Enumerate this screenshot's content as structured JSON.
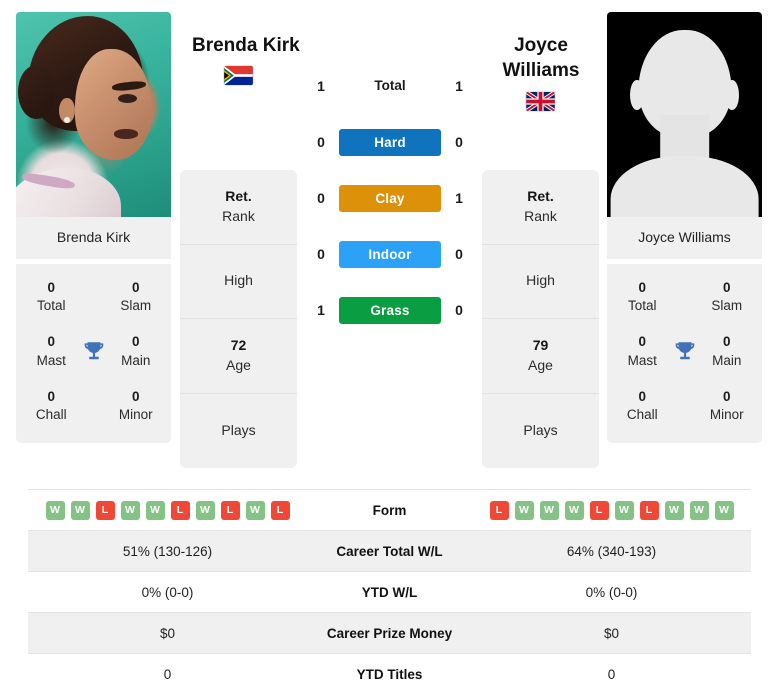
{
  "players": {
    "left": {
      "display_name": "Brenda Kirk",
      "headline": "Brenda Kirk",
      "card_name": "Brenda Kirk",
      "flag": "south-africa-flag",
      "photo": "player-photo",
      "titles": {
        "total": {
          "value": "0",
          "label": "Total"
        },
        "slam": {
          "value": "0",
          "label": "Slam"
        },
        "mast": {
          "value": "0",
          "label": "Mast"
        },
        "main": {
          "value": "0",
          "label": "Main"
        },
        "chall": {
          "value": "0",
          "label": "Chall"
        },
        "minor": {
          "value": "0",
          "label": "Minor"
        }
      },
      "info": {
        "rank_value": "Ret.",
        "rank_label": "Rank",
        "high_value": "",
        "high_label": "High",
        "age_value": "72",
        "age_label": "Age",
        "plays_value": "",
        "plays_label": "Plays"
      },
      "form": [
        "W",
        "W",
        "L",
        "W",
        "W",
        "L",
        "W",
        "L",
        "W",
        "L"
      ],
      "career_total_wl": "51% (130-126)",
      "ytd_wl": "0% (0-0)",
      "career_prize_money": "$0",
      "ytd_titles": "0"
    },
    "right": {
      "display_name": "Joyce Williams",
      "headline_line1": "Joyce",
      "headline_line2": "Williams",
      "card_name": "Joyce Williams",
      "flag": "united-kingdom-flag",
      "photo": "player-photo-placeholder",
      "titles": {
        "total": {
          "value": "0",
          "label": "Total"
        },
        "slam": {
          "value": "0",
          "label": "Slam"
        },
        "mast": {
          "value": "0",
          "label": "Mast"
        },
        "main": {
          "value": "0",
          "label": "Main"
        },
        "chall": {
          "value": "0",
          "label": "Chall"
        },
        "minor": {
          "value": "0",
          "label": "Minor"
        }
      },
      "info": {
        "rank_value": "Ret.",
        "rank_label": "Rank",
        "high_value": "",
        "high_label": "High",
        "age_value": "79",
        "age_label": "Age",
        "plays_value": "",
        "plays_label": "Plays"
      },
      "form": [
        "L",
        "W",
        "W",
        "W",
        "L",
        "W",
        "L",
        "W",
        "W",
        "W"
      ],
      "career_total_wl": "64% (340-193)",
      "ytd_wl": "0% (0-0)",
      "career_prize_money": "$0",
      "ytd_titles": "0"
    }
  },
  "head_to_head": {
    "total": {
      "label": "Total",
      "left": "1",
      "right": "1"
    },
    "surfaces": [
      {
        "label": "Hard",
        "left": "0",
        "right": "0",
        "color": "#0f73bd"
      },
      {
        "label": "Clay",
        "left": "0",
        "right": "1",
        "color": "#dd9108"
      },
      {
        "label": "Indoor",
        "left": "0",
        "right": "0",
        "color": "#2ba1f7"
      },
      {
        "label": "Grass",
        "left": "1",
        "right": "0",
        "color": "#0a9e43"
      }
    ]
  },
  "stats_table": {
    "rows": [
      {
        "label": "Form",
        "type": "form"
      },
      {
        "label": "Career Total W/L",
        "type": "text",
        "left": "51% (130-126)",
        "right": "64% (340-193)"
      },
      {
        "label": "YTD W/L",
        "type": "text",
        "left": "0% (0-0)",
        "right": "0% (0-0)"
      },
      {
        "label": "Career Prize Money",
        "type": "text",
        "left": "$0",
        "right": "$0"
      },
      {
        "label": "YTD Titles",
        "type": "text",
        "left": "0",
        "right": "0"
      }
    ]
  },
  "theme": {
    "card_bg": "#f0f0f0",
    "page_bg": "#ffffff",
    "win_color": "#85c285",
    "loss_color": "#ef4836",
    "trophy_color": "#3f72b8"
  }
}
